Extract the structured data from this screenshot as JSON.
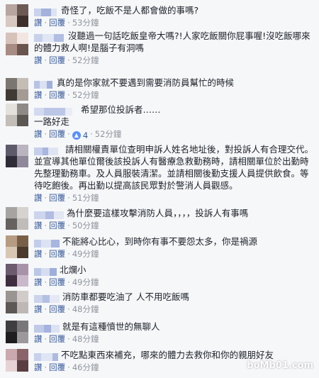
{
  "actions": {
    "like": "讚",
    "reply": "回覆"
  },
  "comments": [
    {
      "text": "奇怪了，吃飯不是人都會做的事嗎?",
      "time": "53分鐘",
      "likes": "",
      "colors": [
        "#b7a5a0",
        "#6e5a55",
        "#d8c8c2",
        "#3d2f2c"
      ],
      "name_colors": [
        "#c9d3ec",
        "#a3b1db",
        "#dde3f3"
      ]
    },
    {
      "text": "沒聽過一句話吃飯皇帝大嗎?!人家吃飯關你屁事喔!沒吃飯哪來的體力救人啊!是腦子有洞嗎",
      "time": "52分鐘",
      "likes": "",
      "colors": [
        "#d7c2ba",
        "#f1e6e1",
        "#a88c83",
        "#6a544e"
      ],
      "name_colors": [
        "#c7d1ea",
        "#e1e6f4",
        "#b1bde2"
      ]
    },
    {
      "text": "真的是你家就不要遇到需要消防員幫忙的時候",
      "time": "52分鐘",
      "likes": "",
      "colors": [
        "#7c7670",
        "#c4bdb6",
        "#3f3a36",
        "#a39b94"
      ],
      "name_colors": [
        "#b8c3e5",
        "#dbe1f2",
        "#9fb0dc"
      ]
    },
    {
      "text": "希望那位投訴者……\n一路好走",
      "time": "52分鐘",
      "likes": "4",
      "colors": [
        "#e4e0dc",
        "#8f8a86",
        "#c3bdb8",
        "#5d5753"
      ],
      "name_colors": [
        "#d3d9ef",
        "#bcc7e7",
        "#e9ecf7"
      ]
    },
    {
      "text": "請相關權責單位查明申訴人姓名地址後，對投訴人有合理交代。並宣導其他單位爾後該投訴人有醫療急救勤務時，請相關單位於出勤時先整理勤務車。及人員服裝清潔。並請相關後勤支援人員提供飲食。等待吃飽後。再出勤以提高該民眾對於警消人員觀感。",
      "time": "51分鐘",
      "likes": "",
      "colors": [
        "#5e5a6a",
        "#b9b4c0",
        "#2f2c38",
        "#8e8899"
      ],
      "name_colors": [
        "#c6cfea",
        "#a9b6df",
        "#dfe4f3"
      ]
    },
    {
      "text": "為什麼要這樣攻擊消防人員，，，，投訴人有事嗎",
      "time": "50分鐘",
      "likes": "",
      "colors": [
        "#a6a3a0",
        "#d5d2cf",
        "#66625f",
        "#c0bcb9"
      ],
      "name_colors": [
        "#cdd5ed",
        "#b0bce2",
        "#e3e7f4"
      ]
    },
    {
      "text": "不能將心比心，到時你有事不要怨太多，你是禍源",
      "time": "49分鐘",
      "likes": "",
      "colors": [
        "#b59b82",
        "#7a5f48",
        "#d9c7b4",
        "#4b3a2c"
      ],
      "name_colors": [
        "#c3cdea",
        "#dde2f3",
        "#a7b5df"
      ]
    },
    {
      "text": "北爛小",
      "time": "49分鐘",
      "likes": "",
      "colors": [
        "#6c5a6e",
        "#a892aa",
        "#3e2f40",
        "#c9b8ca"
      ],
      "name_colors": [
        "#bcc7e6",
        "#d7ddf1",
        "#9eafdb"
      ]
    },
    {
      "text": "消防車都要吃油了 人不用吃飯嗎",
      "time": "48分鐘",
      "likes": "",
      "colors": [
        "#9a9592",
        "#d1ccc9",
        "#5d5855",
        "#bdb8b5"
      ],
      "name_colors": [
        "#ccd4ec",
        "#b3bfe3",
        "#e5e9f5"
      ]
    },
    {
      "text": "就是有這種憤世的無聊人",
      "time": "48分鐘",
      "likes": "",
      "colors": [
        "#3f3d40",
        "#7a777b",
        "#1f1d20",
        "#9c999d"
      ],
      "name_colors": [
        "#c0cae8",
        "#a4b2de",
        "#dce2f2"
      ]
    },
    {
      "text": "不吃點東西來補充，哪來的體力去救你和你的親朋好友",
      "time": "46分鐘",
      "likes": "",
      "colors": [
        "#c9a9ad",
        "#8a6468",
        "#e6d2d4",
        "#5a3d41"
      ],
      "name_colors": [
        "#c8d1eb",
        "#e0e5f3",
        "#adbae0"
      ]
    }
  ],
  "watermark": "boMb01.com"
}
